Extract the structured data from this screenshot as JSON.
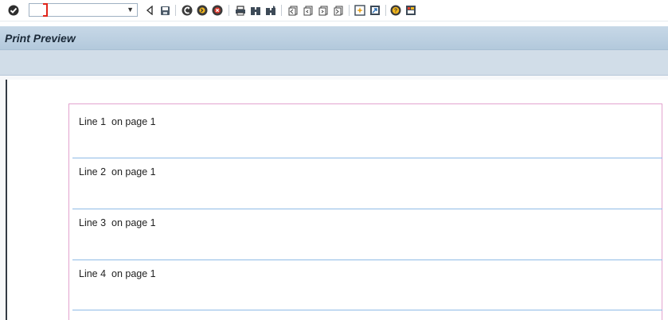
{
  "toolbar": {
    "command_field": {
      "value": "",
      "placeholder": ""
    },
    "icons": [
      "enter-checkmark-icon",
      "command-dropdown-icon",
      "back-arrow-icon",
      "save-icon",
      "back-green-icon",
      "exit-yellow-icon",
      "cancel-red-icon",
      "print-icon",
      "find-icon",
      "find-next-icon",
      "first-page-icon",
      "previous-page-icon",
      "next-page-icon",
      "last-page-icon",
      "create-session-icon",
      "shortcut-icon",
      "help-icon",
      "customize-layout-icon"
    ]
  },
  "window": {
    "title": "Print Preview"
  },
  "preview": {
    "lines": [
      {
        "text": "Line 1  on page 1"
      },
      {
        "text": "Line 2  on page 1"
      },
      {
        "text": "Line 3  on page 1"
      },
      {
        "text": "Line 4  on page 1"
      }
    ]
  },
  "colors": {
    "title_bar": "#b8cde0",
    "app_bar": "#d1dde8",
    "page_border": "#e3a4cf",
    "line_separator": "#8fbbe6"
  }
}
